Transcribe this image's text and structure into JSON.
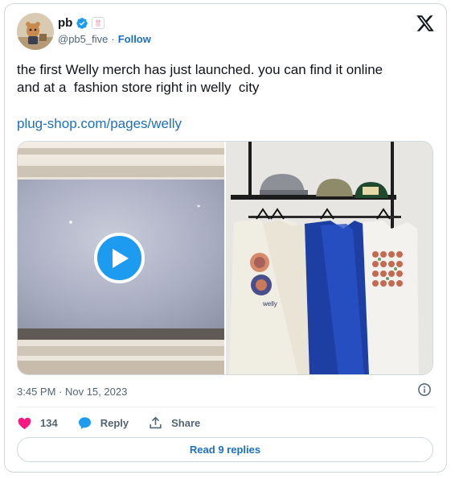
{
  "author": {
    "display_name": "pb",
    "handle": "@pb5_five",
    "separator": "·",
    "follow_label": "Follow"
  },
  "tweet": {
    "text": "the first Welly merch has just launched. you can find it online\nand at a  fashion store right in welly  city",
    "link": "plug-shop.com/pages/welly"
  },
  "media": {
    "video_icon": "play-icon",
    "photo_subject": "t-shirts-and-caps-on-rack",
    "shirt_print_label": "welly"
  },
  "meta": {
    "timestamp": "3:45 PM · Nov 15, 2023"
  },
  "actions": {
    "like_count": "134",
    "reply_label": "Reply",
    "share_label": "Share"
  },
  "read_replies_label": "Read 9 replies",
  "colors": {
    "accent": "#1d9bf0",
    "link": "#1d6fc2",
    "like": "#f91880",
    "muted": "#536471"
  }
}
